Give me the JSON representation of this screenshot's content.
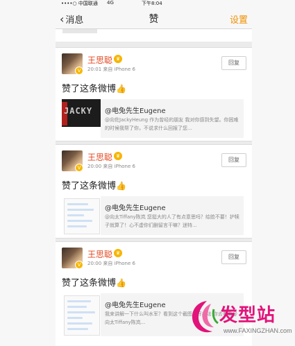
{
  "statusbar": {
    "carrier": "••••○ 中国联通",
    "network": "4G",
    "time": "下午8:04"
  },
  "navbar": {
    "back_label": "消息",
    "title": "赞",
    "settings_label": "设置"
  },
  "cards": [
    {
      "username": "王思聪",
      "timestamp": "20:01",
      "source": "来自 iPhone 6",
      "reply_label": "回复",
      "liked_text": "赞了这条微博",
      "quote_author": "@电兔先生Eugene",
      "quote_body": "@向佐JackyHeung 作为曾经的朋友 我对你感到失望。你困难的时候我帮了你，不说求什么回报了您...",
      "quote_image_text": "JACKY"
    },
    {
      "username": "王思聪",
      "timestamp": "20:00",
      "source": "来自 iPhone 6",
      "reply_label": "回复",
      "liked_text": "赞了这条微博",
      "quote_author": "@电兔先生Eugene",
      "quote_body": "@向太Tiffany陈岚 您挺大的人了有点意思吗？给脸不要！护犊子就算了！心不虚你们删留言干嘛？迷特..."
    },
    {
      "username": "王思聪",
      "timestamp": "20:00",
      "source": "来自 iPhone 6",
      "reply_label": "回复",
      "liked_text": "赞了这条微博",
      "quote_author": "@电兔先生Eugene",
      "quote_body": "我来讲解一下什么叫水军？看到这个截图...好办法 你去看看@向太Tiffany陈岚..."
    }
  ],
  "watermark": {
    "brand": "发型站",
    "url": "www.FAXINGZHAN.com"
  },
  "colors": {
    "accent": "#f09000",
    "username": "#e5461f",
    "watermark": "#e2137a"
  }
}
